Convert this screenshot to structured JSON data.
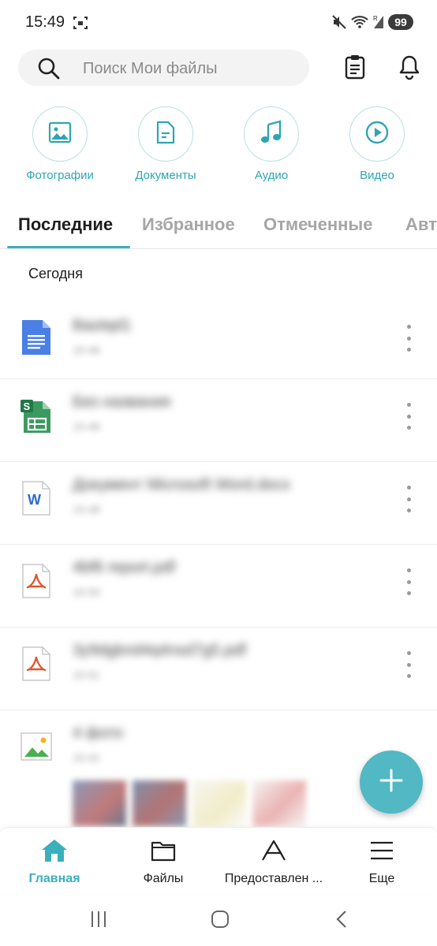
{
  "status_bar": {
    "time": "15:49",
    "battery": "99"
  },
  "search": {
    "placeholder": "Поиск Мои файлы"
  },
  "categories": [
    {
      "label": "Фотографии",
      "icon": "image-icon"
    },
    {
      "label": "Документы",
      "icon": "document-icon"
    },
    {
      "label": "Аудио",
      "icon": "music-icon"
    },
    {
      "label": "Видео",
      "icon": "play-icon"
    }
  ],
  "tabs": [
    {
      "label": "Последние",
      "active": true
    },
    {
      "label": "Избранное"
    },
    {
      "label": "Отмеченные"
    },
    {
      "label": "Авт"
    }
  ],
  "section": {
    "title": "Сегодня"
  },
  "files": [
    {
      "name": "Baotqd1",
      "time": "15:48",
      "type": "docs"
    },
    {
      "name": "Без названия",
      "time": "15:48",
      "type": "sheets"
    },
    {
      "name": "Документ Microsoft Word.docx",
      "time": "15:48",
      "type": "word"
    },
    {
      "name": "4bf6 report.pdf",
      "time": "15:50",
      "type": "pdf"
    },
    {
      "name": "3y9dgbnd4q4nsd7g5.pdf",
      "time": "15:51",
      "type": "pdf"
    },
    {
      "name": "4 фото",
      "time": "15:41",
      "type": "image"
    }
  ],
  "bottom_nav": [
    {
      "label": "Главная",
      "icon": "home-icon",
      "active": true
    },
    {
      "label": "Файлы",
      "icon": "folder-icon"
    },
    {
      "label": "Предоставлен ...",
      "icon": "shared-drive-icon"
    },
    {
      "label": "Еще",
      "icon": "menu-icon"
    }
  ],
  "colors": {
    "accent": "#3ab0bc",
    "fab": "#52b8c3"
  }
}
